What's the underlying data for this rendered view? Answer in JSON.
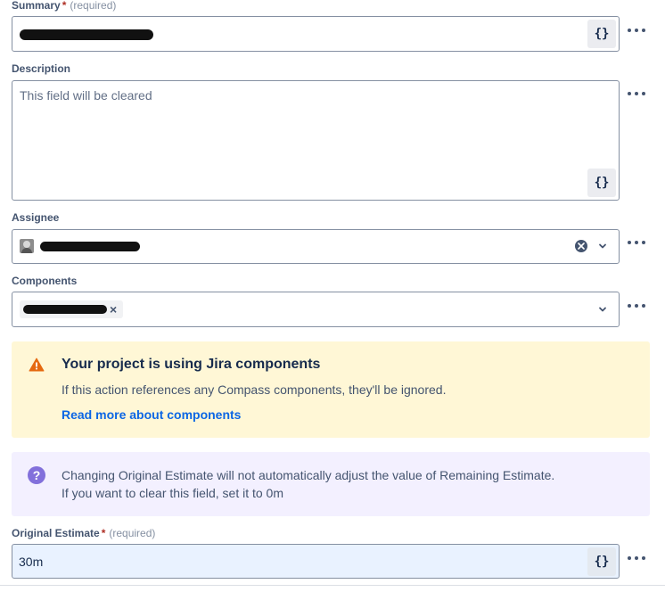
{
  "summary": {
    "label": "Summary",
    "required_mark": "*",
    "hint": "(required)",
    "smart_value_label": "{}"
  },
  "description": {
    "label": "Description",
    "placeholder": "This field will be cleared",
    "smart_value_label": "{}"
  },
  "assignee": {
    "label": "Assignee"
  },
  "components": {
    "label": "Components",
    "chip_remove_label": "×"
  },
  "warning_panel": {
    "title": "Your project is using Jira components",
    "body": "If this action references any Compass components, they'll be ignored.",
    "link": "Read more about components",
    "icon": "warning-icon",
    "color": "#e56910"
  },
  "info_panel": {
    "line1": "Changing Original Estimate will not automatically adjust the value of Remaining Estimate.",
    "line2": "If you want to clear this field, set it to 0m",
    "icon": "question-icon",
    "color": "#8270db"
  },
  "original_estimate": {
    "label": "Original Estimate",
    "required_mark": "*",
    "hint": "(required)",
    "value": "30m",
    "smart_value_label": "{}"
  },
  "more_actions_label": "•••"
}
